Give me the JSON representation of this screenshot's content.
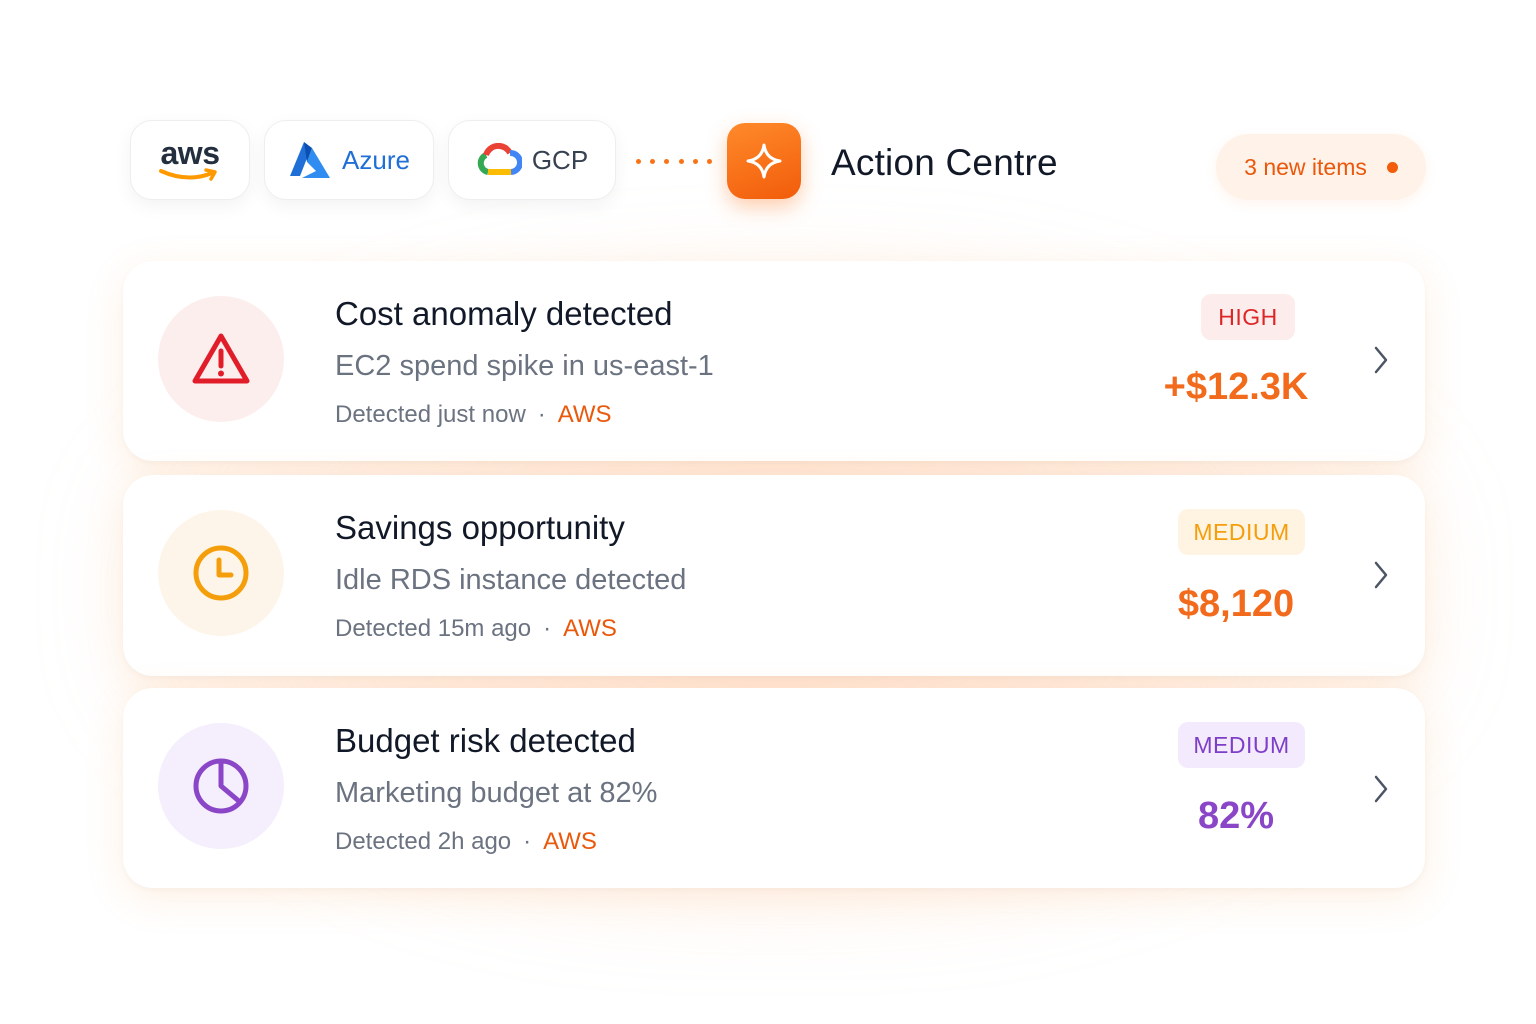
{
  "header": {
    "providers": [
      {
        "name": "aws",
        "icon": "aws-smile-logo"
      },
      {
        "name": "Azure",
        "icon": "azure-logo"
      },
      {
        "name": "GCP",
        "icon": "google-cloud-logo"
      }
    ],
    "title": "Action Centre",
    "title_icon": "sparkle-icon",
    "new_items": "3 new items",
    "accent_color": "#f97316"
  },
  "cards": [
    {
      "title": "Cost anomaly detected",
      "subtitle": "EC2 spend spike in us-east-1",
      "detected": "Detected just now",
      "separator": "·",
      "provider": "AWS",
      "severity": "HIGH",
      "value": "+$12.3K",
      "icon": "warning-triangle-icon",
      "color": "#dc2626"
    },
    {
      "title": "Savings opportunity",
      "subtitle": "Idle RDS instance detected",
      "detected": "Detected 15m ago",
      "separator": "·",
      "provider": "AWS",
      "severity": "MEDIUM",
      "value": "$8,120",
      "icon": "clock-icon",
      "color": "#f59e0b"
    },
    {
      "title": "Budget risk detected",
      "subtitle": "Marketing budget at 82%",
      "detected": "Detected 2h ago",
      "separator": "·",
      "provider": "AWS",
      "severity": "MEDIUM",
      "value": "82%",
      "icon": "pie-chart-icon",
      "color": "#8b46c8"
    }
  ]
}
